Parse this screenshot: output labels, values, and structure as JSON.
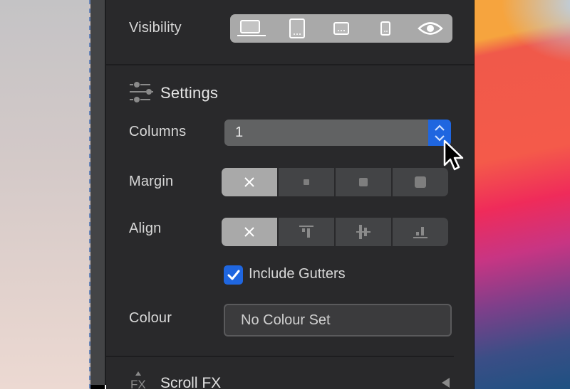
{
  "panel": {
    "visibility": {
      "label": "Visibility",
      "options": [
        {
          "name": "desktop",
          "icon": "laptop-icon",
          "active": true
        },
        {
          "name": "tablet-portrait",
          "icon": "tablet-portrait-icon",
          "active": false
        },
        {
          "name": "tablet-landscape",
          "icon": "tablet-landscape-icon",
          "active": false
        },
        {
          "name": "phone",
          "icon": "phone-icon",
          "active": false
        },
        {
          "name": "visible",
          "icon": "eye-icon",
          "active": false
        }
      ]
    },
    "settings": {
      "title": "Settings",
      "icon": "sliders-icon",
      "columns": {
        "label": "Columns",
        "value": "1"
      },
      "margin": {
        "label": "Margin",
        "options": [
          "none",
          "small",
          "medium",
          "large"
        ],
        "selected": "none"
      },
      "align": {
        "label": "Align",
        "options": [
          "none",
          "top",
          "middle",
          "bottom"
        ],
        "selected": "none"
      },
      "include_gutters": {
        "label": "Include Gutters",
        "checked": true
      },
      "colour": {
        "label": "Colour",
        "value": "No Colour Set"
      }
    },
    "scroll_fx": {
      "title": "Scroll FX",
      "icon": "fx-icon",
      "expanded": false
    }
  },
  "colors": {
    "accent": "#1f66e0",
    "panel_bg": "#29292b",
    "segment_active": "#a9a9a9",
    "segment_bg": "#434446"
  }
}
